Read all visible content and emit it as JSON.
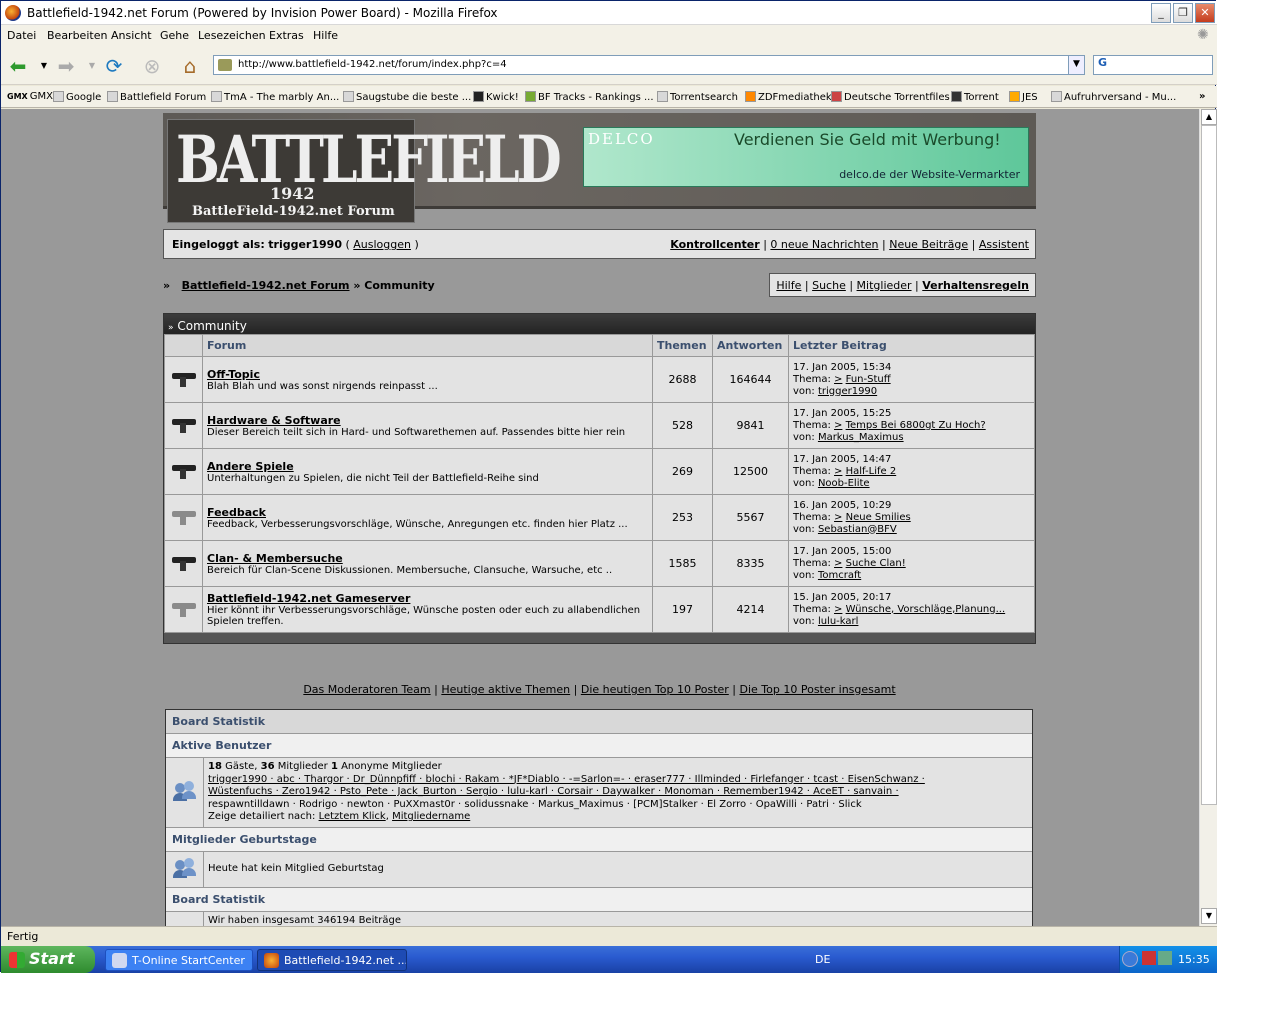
{
  "window": {
    "title": "Battlefield-1942.net Forum (Powered by Invision Power Board) - Mozilla Firefox"
  },
  "menu": [
    "Datei",
    "Bearbeiten",
    "Ansicht",
    "Gehe",
    "Lesezeichen",
    "Extras",
    "Hilfe"
  ],
  "address": {
    "url": "http://www.battlefield-1942.net/forum/index.php?c=4"
  },
  "bookmarks": [
    "GMX",
    "Google",
    "Battlefield Forum",
    "TmA - The marbly An...",
    "Saugstube die beste ...",
    "Kwick!",
    "BF Tracks - Rankings ...",
    "Torrentsearch",
    "ZDFmediathek",
    "Deutsche Torrentfiles",
    "Torrent",
    "JES",
    "Aufruhrversand - Mu..."
  ],
  "banner": {
    "logo_main": "BATTLEFIELD",
    "logo_num": "1942",
    "logo_sub": "BattleField-1942.net Forum",
    "ad_brand": "DELCO",
    "ad_slogan": "Verdienen Sie Geld mit Werbung!",
    "ad_sub": "delco.de der Website-Vermarkter"
  },
  "userbar": {
    "logged_in_label": "Eingeloggt als:",
    "user": "trigger1990",
    "logout": "Ausloggen",
    "links": [
      "Kontrollcenter",
      "0 neue Nachrichten",
      "Neue Beiträge",
      "Assistent"
    ]
  },
  "breadcrumb": {
    "root": "Battlefield-1942.net Forum",
    "current": "Community"
  },
  "toplinks": [
    "Hilfe",
    "Suche",
    "Mitglieder",
    "Verhaltensregeln"
  ],
  "category": {
    "title": "Community",
    "headers": [
      "Forum",
      "Themen",
      "Antworten",
      "Letzter Beitrag"
    ],
    "forums": [
      {
        "name": "Off-Topic",
        "desc": "Blah Blah und was sonst nirgends reinpasst ...",
        "topics": "2688",
        "replies": "164644",
        "date": "17. Jan 2005, 15:34",
        "thema_label": "Thema:",
        "thema": "Fun-Stuff",
        "von_label": "von:",
        "von": "trigger1990",
        "dim": false
      },
      {
        "name": "Hardware & Software",
        "desc": "Dieser Bereich teilt sich in Hard- und Softwarethemen auf. Passendes bitte hier rein",
        "topics": "528",
        "replies": "9841",
        "date": "17. Jan 2005, 15:25",
        "thema_label": "Thema:",
        "thema": "Temps Bei 6800gt Zu Hoch?",
        "von_label": "von:",
        "von": "Markus_Maximus",
        "dim": false
      },
      {
        "name": "Andere Spiele",
        "desc": "Unterhaltungen zu Spielen, die nicht Teil der Battlefield-Reihe sind",
        "topics": "269",
        "replies": "12500",
        "date": "17. Jan 2005, 14:47",
        "thema_label": "Thema:",
        "thema": "Half-Life 2",
        "von_label": "von:",
        "von": "Noob-Elite",
        "dim": false
      },
      {
        "name": "Feedback",
        "desc": "Feedback, Verbesserungsvorschläge, Wünsche, Anregungen etc. finden hier Platz ...",
        "topics": "253",
        "replies": "5567",
        "date": "16. Jan 2005, 10:29",
        "thema_label": "Thema:",
        "thema": "Neue Smilies",
        "von_label": "von:",
        "von": "Sebastian@BFV",
        "dim": true
      },
      {
        "name": "Clan- & Membersuche",
        "desc": "Bereich für Clan-Scene Diskussionen. Membersuche, Clansuche, Warsuche, etc ..",
        "topics": "1585",
        "replies": "8335",
        "date": "17. Jan 2005, 15:00",
        "thema_label": "Thema:",
        "thema": "Suche Clan!",
        "von_label": "von:",
        "von": "Tomcraft",
        "dim": false
      },
      {
        "name": "Battlefield-1942.net Gameserver",
        "desc": "Hier könnt ihr Verbesserungsvorschläge, Wünsche posten oder euch zu allabendlichen Spielen treffen.",
        "topics": "197",
        "replies": "4214",
        "date": "15. Jan 2005, 20:17",
        "thema_label": "Thema:",
        "thema": "Wünsche, Vorschläge,Planung...",
        "von_label": "von:",
        "von": "lulu-karl",
        "dim": true
      }
    ]
  },
  "bottomlinks": [
    "Das Moderatoren Team",
    "Heutige aktive Themen",
    "Die heutigen Top 10 Poster",
    "Die Top 10 Poster insgesamt"
  ],
  "stats": {
    "title": "Board Statistik",
    "active_title": "Aktive Benutzer",
    "guests": "18",
    "guests_label": "Gäste,",
    "members": "36",
    "members_label": "Mitglieder",
    "anon": "1",
    "anon_label": "Anonyme Mitglieder",
    "members_list_1": "trigger1990 · abc · Thargor · Dr_Dünnpfiff · blochi · Rakam · *JF*Diablo · -=Sarlon=- · eraser777 · Illminded · Firlefanger · tcast · EisenSchwanz ·",
    "members_list_2": "Wüstenfuchs · Zero1942 · Psto_Pete · Jack_Burton · Sergio · lulu-karl · Corsair · Daywalker · Monoman · Remember1942 · AceET · sanvain ·",
    "members_list_3": "respawntilldawn · Rodrigo · newton · PuXXmast0r · solidussnake · Markus_Maximus · [PCM]Stalker · El Zorro · OpaWilli · Patri · Slick",
    "detail_label": "Zeige detailiert nach:",
    "detail_links": [
      "Letztem Klick",
      "Mitgliedername"
    ],
    "birthday_title": "Mitglieder Geburtstage",
    "birthday_text": "Heute hat kein Mitglied Geburtstag",
    "stats_title2": "Board Statistik",
    "posts_text": "Wir haben insgesamt 346194 Beiträge"
  },
  "statusbar": {
    "text": "Fertig"
  },
  "taskbar": {
    "start": "Start",
    "tasks": [
      "T-Online StartCenter",
      "Battlefield-1942.net ..."
    ],
    "lang": "DE",
    "clock": "15:35"
  }
}
